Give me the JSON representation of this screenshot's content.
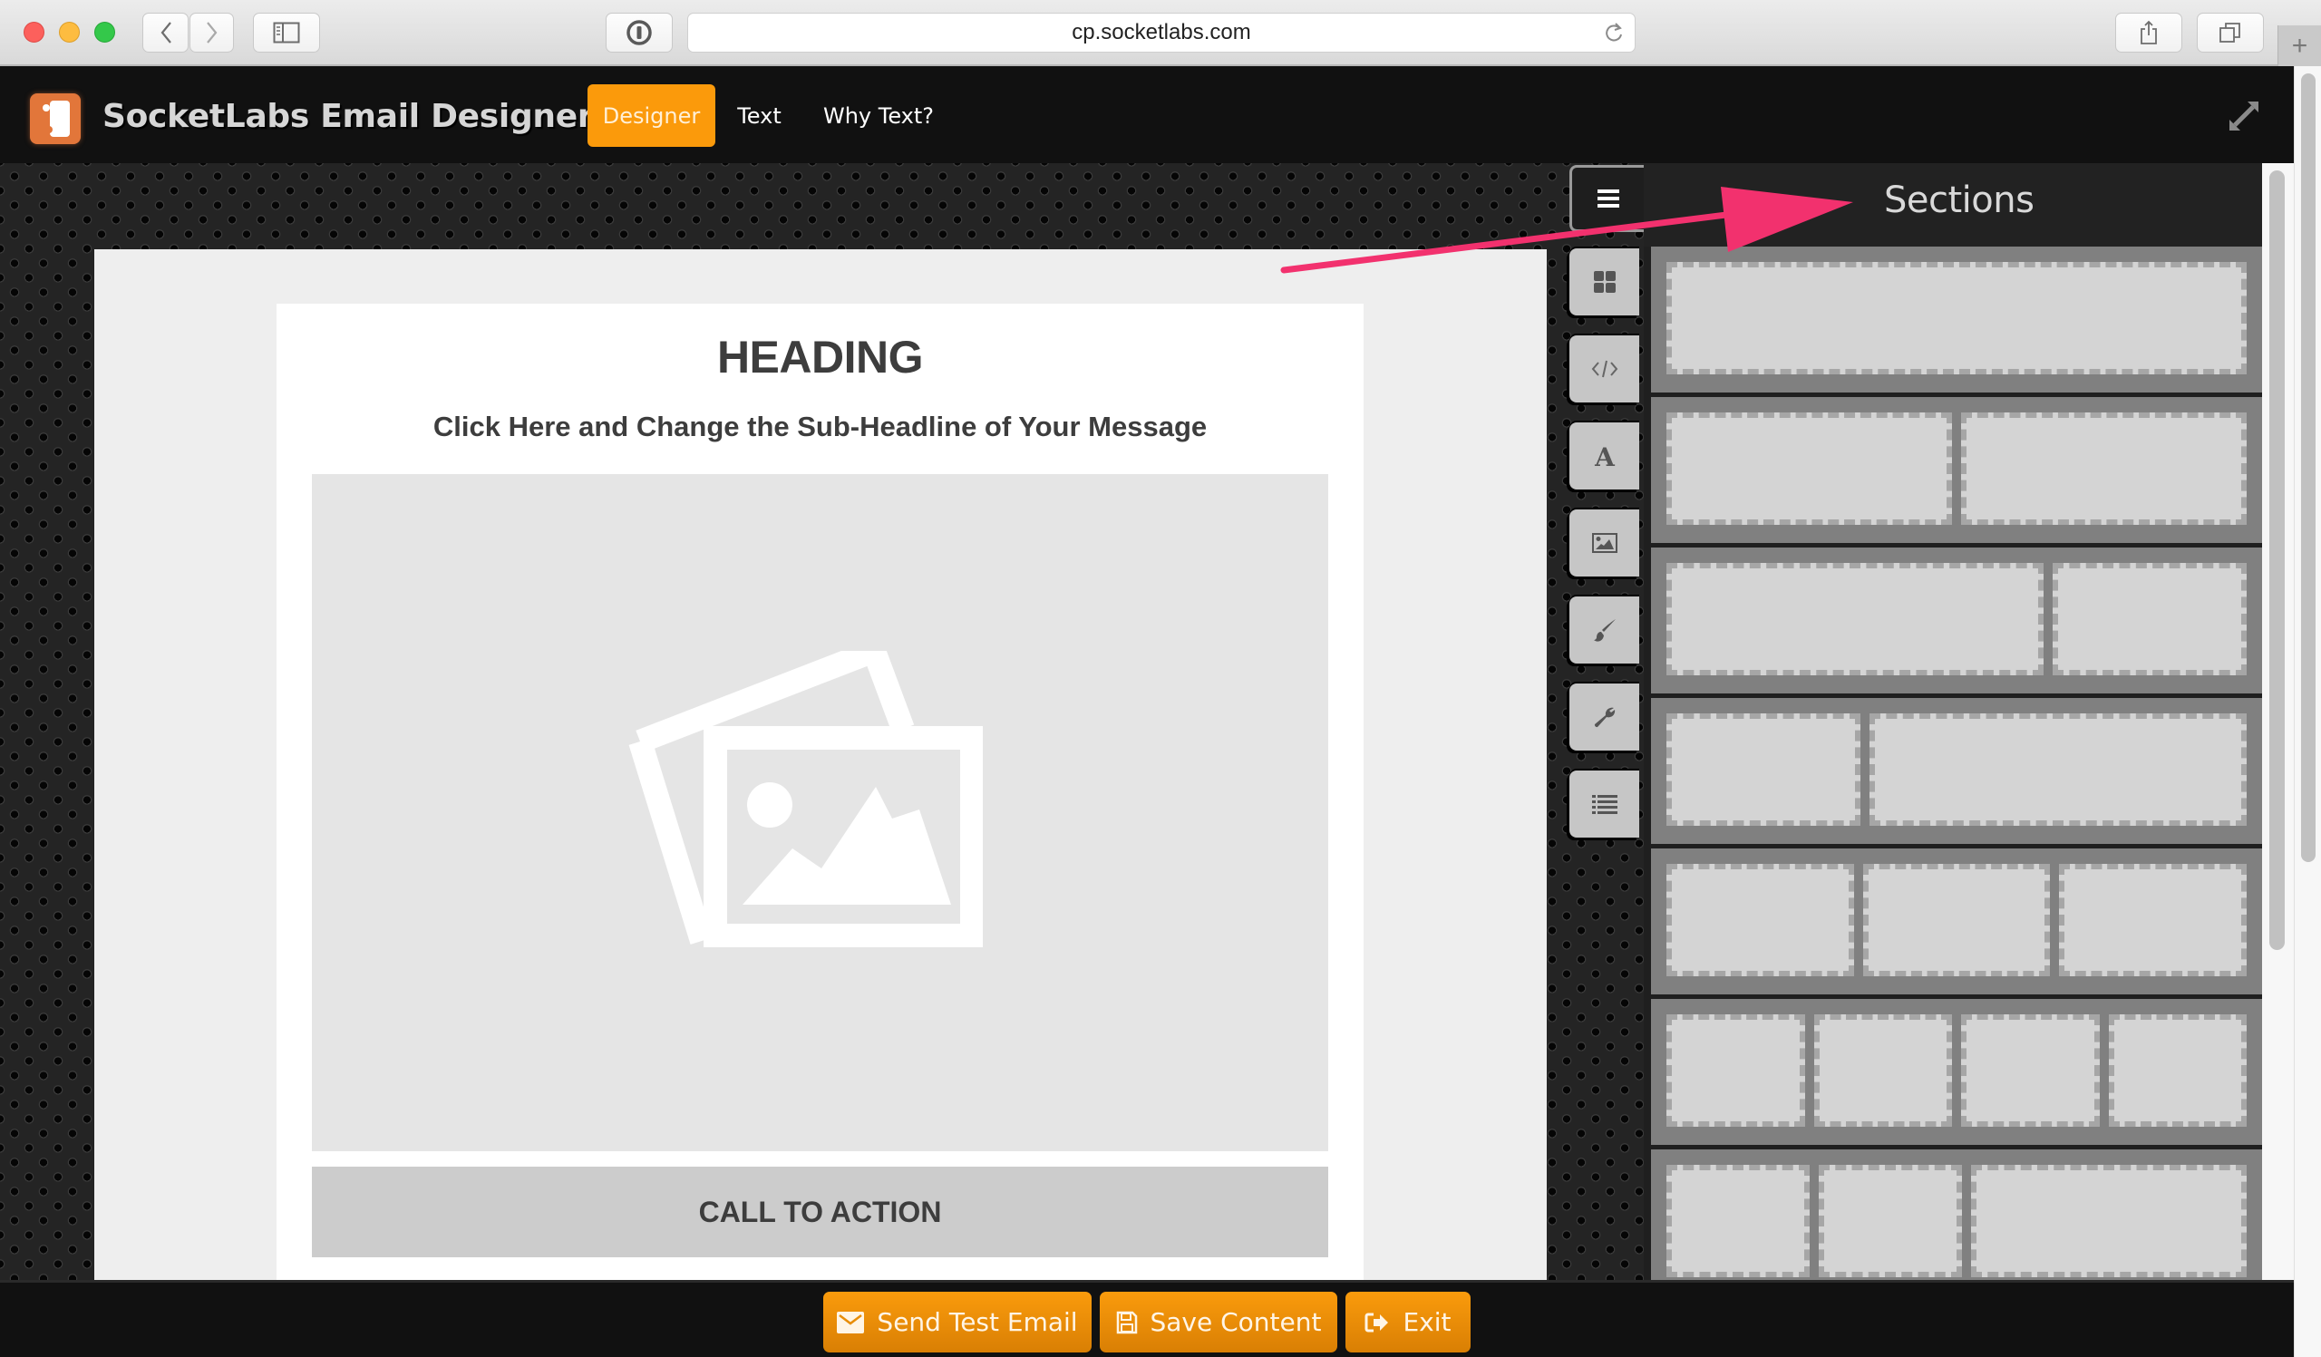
{
  "browser": {
    "url": "cp.socketlabs.com",
    "icons": {
      "back": "chevron-left-icon",
      "forward": "chevron-right-icon",
      "sidebar": "sidebar-icon",
      "password": "1password-icon",
      "reload": "reload-icon",
      "share": "share-icon",
      "tabs": "tabs-icon",
      "new_tab": "plus-icon"
    },
    "new_tab_label": "+"
  },
  "header": {
    "app_title": "SocketLabs Email Designer",
    "nav": [
      {
        "label": "Designer",
        "active": true
      },
      {
        "label": "Text",
        "active": false
      },
      {
        "label": "Why Text?",
        "active": false
      }
    ],
    "fullscreen_icon": "expand-icon",
    "accent_color": "#fb9a0b"
  },
  "email": {
    "heading": "HEADING",
    "subheading": "Click Here and Change the Sub-Headline of Your Message",
    "image_placeholder_icon": "image-placeholder-icon",
    "cta_label": "CALL TO ACTION"
  },
  "tools": [
    {
      "name": "sections",
      "icon": "grid-icon"
    },
    {
      "name": "html",
      "icon": "code-icon"
    },
    {
      "name": "text",
      "icon": "font-icon"
    },
    {
      "name": "image",
      "icon": "image-icon"
    },
    {
      "name": "style",
      "icon": "paintbrush-icon"
    },
    {
      "name": "settings",
      "icon": "wrench-icon"
    },
    {
      "name": "list",
      "icon": "list-icon"
    }
  ],
  "panel": {
    "title": "Sections",
    "menu_icon": "hamburger-icon",
    "layouts": [
      {
        "name": "one-column",
        "columns": [
          1
        ]
      },
      {
        "name": "two-column-equal",
        "columns": [
          1,
          1
        ]
      },
      {
        "name": "two-column-wide-left",
        "columns": [
          2,
          1
        ]
      },
      {
        "name": "two-column-wide-right",
        "columns": [
          1,
          2
        ]
      },
      {
        "name": "three-column",
        "columns": [
          1,
          1,
          1
        ]
      },
      {
        "name": "four-column",
        "columns": [
          1,
          1,
          1,
          1
        ]
      },
      {
        "name": "three-column-wide-right",
        "columns": [
          1,
          1,
          2
        ]
      }
    ]
  },
  "annotation": {
    "arrow_color": "#f2316e",
    "points_to": "Sections"
  },
  "actions": [
    {
      "label": "Send Test Email",
      "icon": "envelope-icon"
    },
    {
      "label": "Save Content",
      "icon": "floppy-disk-icon"
    },
    {
      "label": "Exit",
      "icon": "sign-out-icon"
    }
  ]
}
